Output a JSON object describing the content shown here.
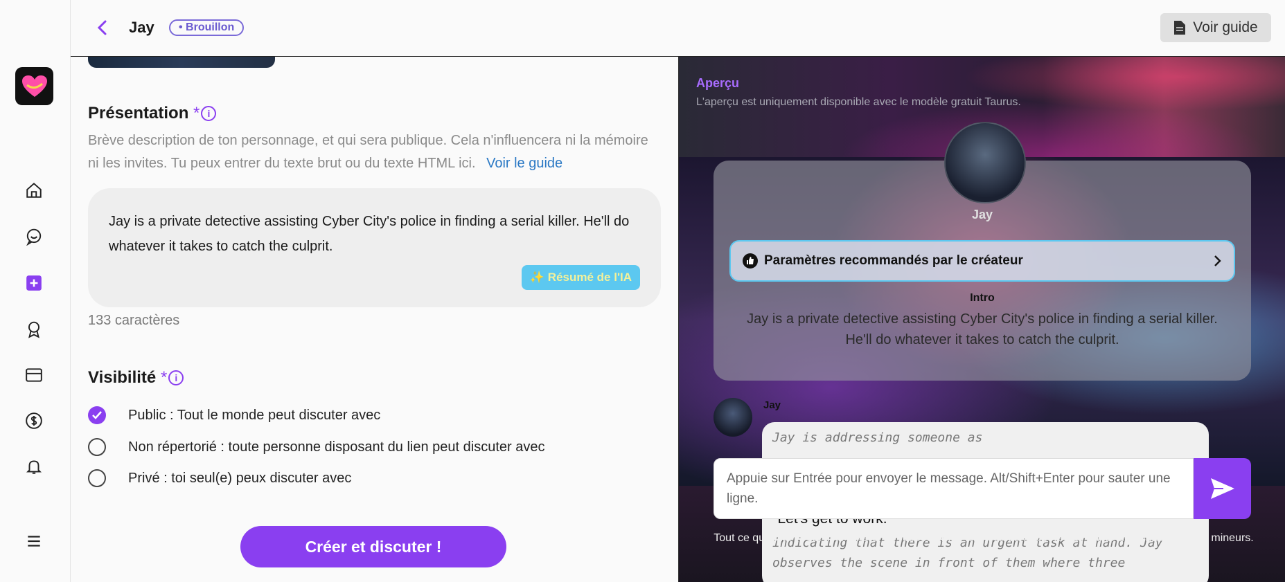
{
  "header": {
    "character_name": "Jay",
    "status": "• Brouillon",
    "guide_button": "Voir guide"
  },
  "sidebar": {
    "items": [
      {
        "name": "home-icon"
      },
      {
        "name": "chat-icon"
      },
      {
        "name": "create-icon"
      },
      {
        "name": "badge-icon"
      },
      {
        "name": "card-icon"
      },
      {
        "name": "dollar-icon"
      },
      {
        "name": "bell-icon"
      },
      {
        "name": "menu-icon"
      }
    ]
  },
  "presentation": {
    "title": "Présentation",
    "required_mark": "*",
    "help_text": "Brève description de ton personnage, et qui sera publique. Cela n'influencera ni la mémoire ni les invites. Tu peux entrer du texte brut ou du texte HTML ici.",
    "guide_link": "Voir le guide",
    "text": "Jay is a private detective assisting Cyber City's police in finding a serial killer. He'll do whatever it takes to catch the culprit.",
    "ai_button": "✨ Résumé de l'IA",
    "char_count": "133 caractères"
  },
  "visibility": {
    "title": "Visibilité",
    "required_mark": "*",
    "options": [
      {
        "label": "Public : Tout le monde peut discuter avec",
        "selected": true
      },
      {
        "label": "Non répertorié : toute personne disposant du lien peut discuter avec",
        "selected": false
      },
      {
        "label": "Privé : toi seul(e) peux discuter avec",
        "selected": false
      }
    ]
  },
  "create_button": "Créer et discuter !",
  "preview": {
    "title": "Aperçu",
    "subtitle": "L'aperçu est uniquement disponible avec le modèle gratuit Taurus.",
    "char_name": "Jay",
    "params_button": "Paramètres recommandés par le créateur",
    "intro_label": "Intro",
    "intro_text": "Jay is a private detective assisting Cyber City's police in finding a serial killer. He'll do whatever it takes to catch the culprit.",
    "message_sender": "Jay",
    "message_lines": [
      "Jay is addressing someone as",
      "indicating that there is an urgent task at hand. Jay",
      "observes the scene in front of them where three"
    ],
    "message_quote": "\"Let's get to work.\"",
    "input_placeholder": "Appuie sur Entrée pour envoyer le message. Alt/Shift+Enter pour sauter une ligne.",
    "disclaimer": "Tout ce que dit l'IA est fictif ! Merci de respecter les lois locales et de ne pas parler de contenu lié aux mineurs."
  },
  "colors": {
    "accent": "#8a3ff0",
    "link": "#2a78c4",
    "ai_button": "#5cc8f0"
  }
}
